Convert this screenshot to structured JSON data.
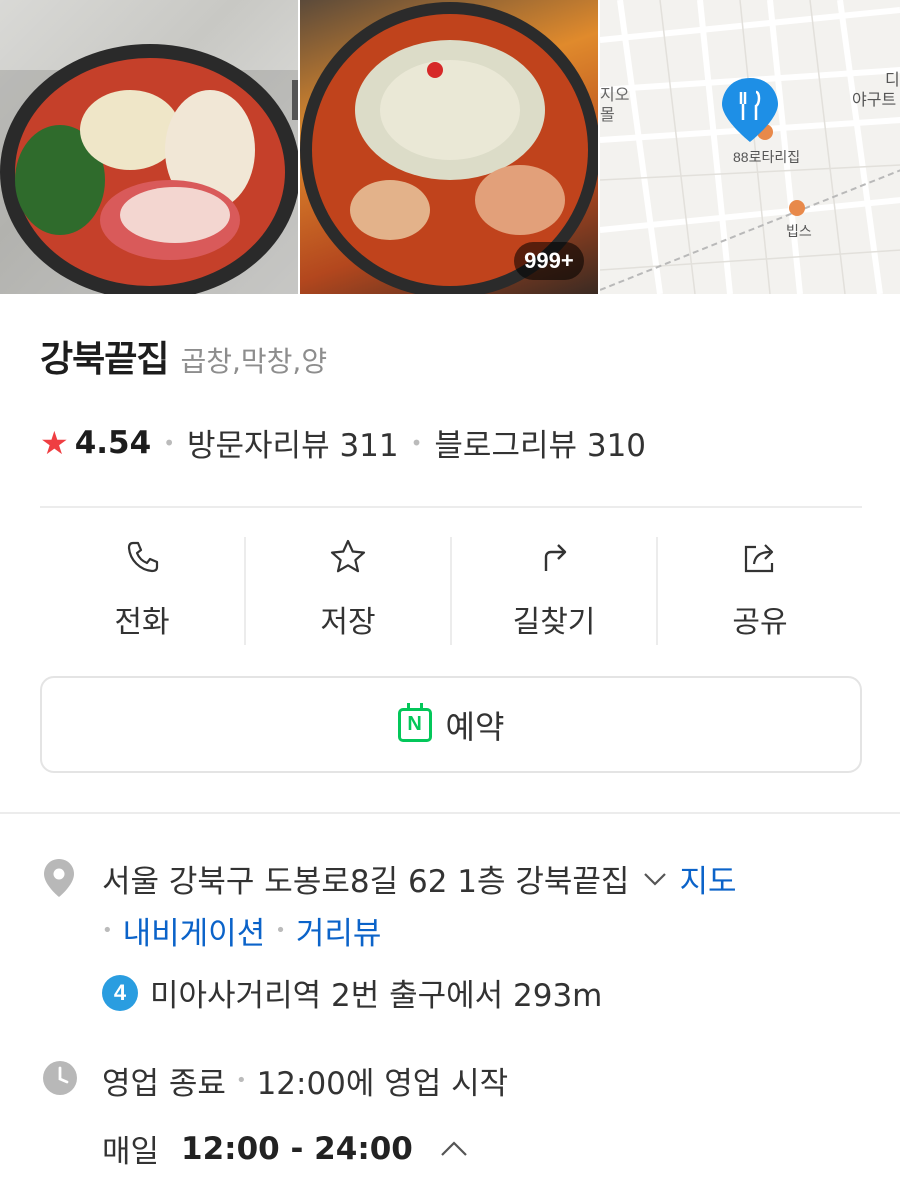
{
  "photos": {
    "count_badge": "999+",
    "map_labels": [
      "디",
      "야구트",
      "지오",
      "몰",
      "88로타리집",
      "빕스"
    ]
  },
  "place": {
    "name": "강북끝집",
    "category": "곱창,막창,양"
  },
  "rating": {
    "value": "4.54",
    "visitor_reviews": "방문자리뷰 311",
    "blog_reviews": "블로그리뷰 310"
  },
  "actions": [
    {
      "label": "전화",
      "icon": "phone-icon"
    },
    {
      "label": "저장",
      "icon": "star-outline-icon"
    },
    {
      "label": "길찾기",
      "icon": "directions-icon"
    },
    {
      "label": "공유",
      "icon": "share-icon"
    }
  ],
  "reserve": {
    "label": "예약",
    "icon": "naver-booking-icon"
  },
  "address": {
    "text": "서울 강북구 도봉로8길 62 1층 강북끝집",
    "map_link": "지도",
    "navigation_link": "내비게이션",
    "streetview_link": "거리뷰",
    "subway_line": "4",
    "subway_text": "미아사거리역 2번 출구에서 293m"
  },
  "hours": {
    "status": "영업 종료",
    "next_open": "12:00에 영업 시작",
    "day": "매일",
    "time": "12:00 - 24:00"
  },
  "colors": {
    "star": "#ef3e42",
    "link": "#0b63c9",
    "naver_green": "#03c75a",
    "subway_line4": "#2a9de0",
    "map_pin": "#1e8fe6"
  }
}
